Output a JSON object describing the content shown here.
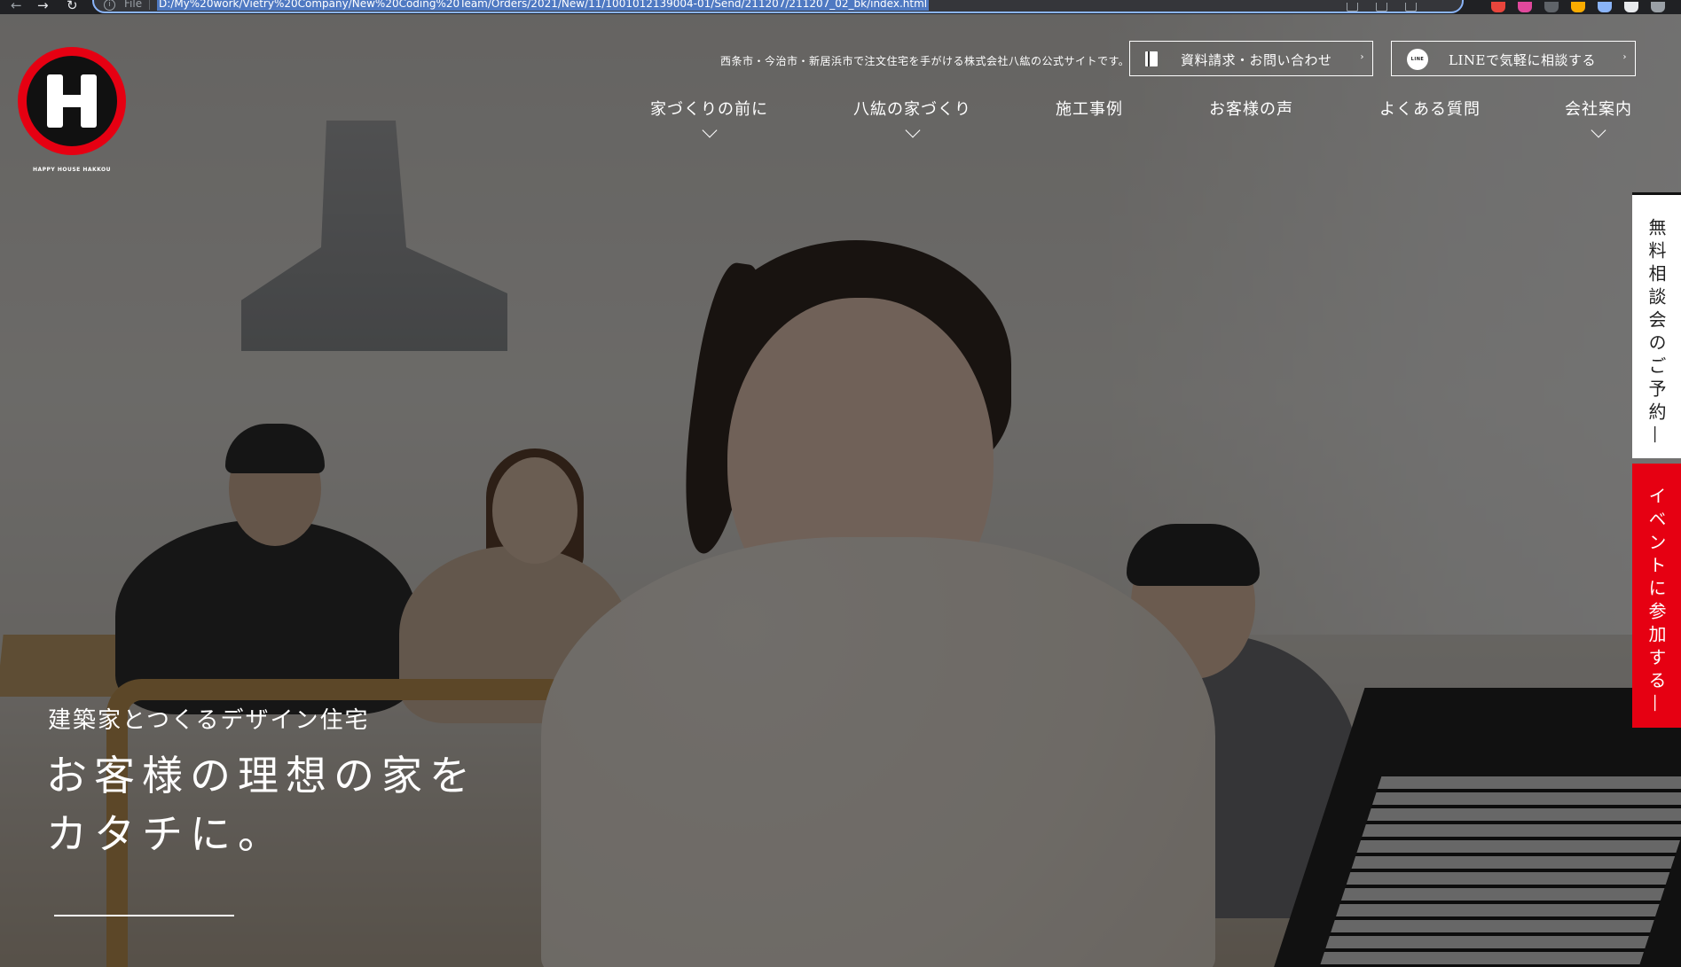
{
  "browser": {
    "back_glyph": "←",
    "forward_glyph": "→",
    "reload_glyph": "↻",
    "info_glyph": "i",
    "scheme_label": "File",
    "url": "D:/My%20work/Vietry%20Company/New%20Coding%20Team/Orders/2021/New/11/1001012139004-01/Send/211207/211207_02_bk/index.html",
    "extension_colors": [
      "#e8453c",
      "#e0489c",
      "#5f6368",
      "#f9ab00",
      "#8ab4f8",
      "#e8eaed",
      "#9aa0a6"
    ]
  },
  "site": {
    "logo_text": "HAPPY HOUSE HAKKOU",
    "tagline": "西条市・今治市・新居浜市で注文住宅を手がける株式会社八紘の公式サイトです。",
    "contact_button": "資料請求・お問い合わせ",
    "line_button": "LINEで気軽に相談する",
    "line_icon_text": "LINE",
    "chevron_glyph": "›",
    "accent_color": "#e60012"
  },
  "nav": {
    "items": [
      {
        "label": "家づくりの前に",
        "has_dropdown": true
      },
      {
        "label": "八紘の家づくり",
        "has_dropdown": true
      },
      {
        "label": "施工事例",
        "has_dropdown": false
      },
      {
        "label": "お客様の声",
        "has_dropdown": false
      },
      {
        "label": "よくある質問",
        "has_dropdown": false
      },
      {
        "label": "会社案内",
        "has_dropdown": true
      }
    ]
  },
  "hero": {
    "subcopy": "建築家とつくるデザイン住宅",
    "main_line1": "お客様の理想の家を",
    "main_line2": "カタチに。"
  },
  "side_tabs": {
    "consult": "無料相談会のご予約",
    "event": "イベントに参加する",
    "dash_glyph": "—"
  }
}
